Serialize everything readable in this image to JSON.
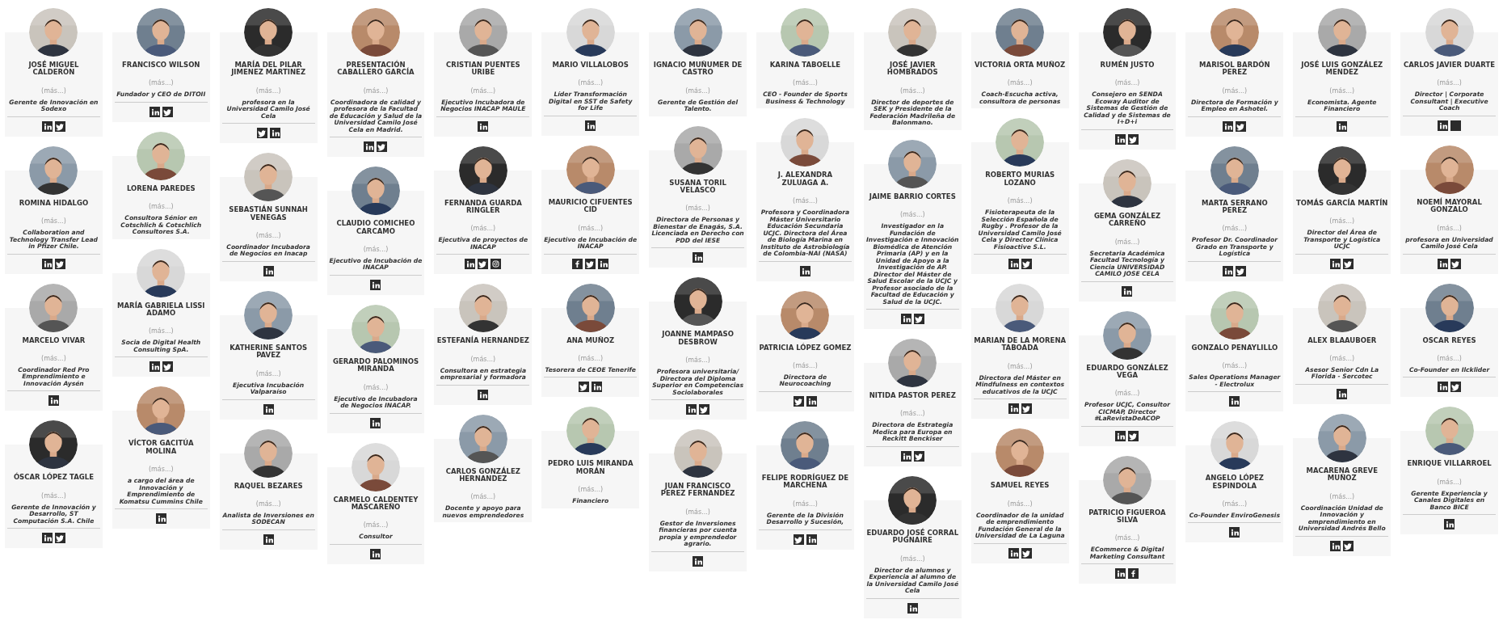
{
  "rows": [
    [
      {
        "name": "JOSÉ MIGUEL CALDERÓN",
        "more": "(más...)",
        "role": "Gerente de Innovación en Sodexo",
        "socials": [
          {
            "kind": "linkedin"
          },
          {
            "kind": "twitter"
          }
        ]
      },
      {
        "name": "FRANCISCO WILSON",
        "more": "(más...)",
        "role": "Fundador y CEO de DITOII",
        "socials": [
          {
            "kind": "linkedin"
          },
          {
            "kind": "twitter"
          }
        ]
      },
      {
        "name": "MARÍA DEL PILAR JIMENEZ MARTINEZ",
        "more": "(más...)",
        "role": "profesora en la Universidad Camilo José Cela",
        "socials": [
          {
            "kind": "twitter"
          },
          {
            "kind": "linkedin"
          }
        ]
      },
      {
        "name": "PRESENTACIÓN CABALLERO GARCÍA",
        "more": "(más...)",
        "role": "Coordinadora de calidad y profesora de la Facultad de Educación y Salud de la Universidad Camilo José Cela en Madrid.",
        "socials": [
          {
            "kind": "linkedin"
          },
          {
            "kind": "twitter"
          }
        ]
      },
      {
        "name": "CRISTIAN PUENTES URIBE",
        "more": "(más...)",
        "role": "Ejecutivo Incubadora de Negocios INACAP MAULE",
        "socials": [
          {
            "kind": "linkedin"
          }
        ]
      },
      {
        "name": "MARIO VILLALOBOS",
        "more": "(más...)",
        "role": "Líder Transformación Digital en SST de Safety for Life",
        "socials": [
          {
            "kind": "linkedin"
          }
        ]
      },
      {
        "name": "IGNACIO MUÑUMER DE CASTRO",
        "more": "(más...)",
        "role": "Gerente de Gestión del Talento."
      },
      {
        "name": "KARINA TABOELLE",
        "more": "(más...)",
        "role": "CEO - Founder de Sports Business & Technology"
      },
      {
        "name": "JOSÉ JAVIER HOMBRADOS",
        "more": "(más...)",
        "role": "Director de deportes de SEK y Presidente de la Federación Madrileña de Balonmano."
      },
      {
        "name": "VICTORIA ORTA MUÑOZ",
        "more": "(más...)",
        "role": "Coach-Escucha activa, consultora de personas"
      },
      {
        "name": "RUMÉN JUSTO",
        "more": "(más...)",
        "role": "Consejero en SENDA Ecoway Auditor de Sistemas de Gestión de Calidad y de Sistemas de I+D+i",
        "socials": [
          {
            "kind": "linkedin"
          },
          {
            "kind": "twitter"
          }
        ]
      },
      {
        "name": "MARISOL BARDÓN PEREZ",
        "more": "(más...)",
        "role": "Directora de Formación y Empleo en Ashotel.",
        "socials": [
          {
            "kind": "linkedin"
          },
          {
            "kind": "twitter"
          }
        ]
      },
      {
        "name": "JOSÉ LUIS GONZÁLEZ MENDEZ",
        "more": "(más...)",
        "role": "Economista. Agente Financiero",
        "socials": [
          {
            "kind": "linkedin"
          }
        ]
      },
      {
        "name": "CARLOS JAVIER DUARTE",
        "more": "(más...)",
        "role": "Director | Corporate Consultant | Executive Coach",
        "socials": [
          {
            "kind": "linkedin"
          },
          {
            "kind": "blank"
          }
        ]
      }
    ],
    [
      {
        "name": "ROMINA HIDALGO",
        "more": "(más...)",
        "role": "Collaboration and Technology Transfer Lead in Pfizer Chile.",
        "socials": [
          {
            "kind": "linkedin"
          },
          {
            "kind": "twitter"
          }
        ]
      },
      {
        "name": "LORENA PAREDES",
        "more": "(más...)",
        "role": "Consultora Sénior en Cotschlich & Cotschlich Consultores S.A."
      },
      {
        "name": "SEBASTIÁN SUNNAH VENEGAS",
        "more": "(más...)",
        "role": "Coordinador Incubadora de Negocios en Inacap",
        "socials": [
          {
            "kind": "linkedin"
          }
        ]
      },
      {
        "name": "CLAUDIO COMICHEO CARCAMO",
        "more": "(más...)",
        "role": "Ejecutivo de Incubación de INACAP",
        "socials": [
          {
            "kind": "linkedin"
          }
        ]
      },
      {
        "name": "FERNANDA GUARDA RINGLER",
        "more": "(más...)",
        "role": "Ejecutiva de proyectos de INACAP",
        "socials": [
          {
            "kind": "linkedin"
          },
          {
            "kind": "twitter"
          },
          {
            "kind": "instagram"
          }
        ]
      },
      {
        "name": "MAURICIO CIFUENTES CID",
        "more": "(más...)",
        "role": "Ejecutivo de Incubación de INACAP",
        "socials": [
          {
            "kind": "facebook"
          },
          {
            "kind": "twitter"
          },
          {
            "kind": "linkedin"
          }
        ]
      },
      {
        "name": "SUSANA TORIL VELASCO",
        "more": "(más...)",
        "role": "Directora de Personas y Bienestar de Enagás, S.A. Licenciada en Derecho con PDD del IESE",
        "socials": [
          {
            "kind": "linkedin"
          }
        ]
      },
      {
        "name": "J. ALEXANDRA ZULUAGA A.",
        "more": "(más...)",
        "role": "Profesora y Coordinadora Máster Universitario Educación Secundaria UCJC. Directora del Área de Biología Marina en Instituto de Astrobiología de Colombia-NAI (NASA)",
        "socials": [
          {
            "kind": "linkedin"
          }
        ]
      },
      {
        "name": "JAIME BARRIO CORTES",
        "more": "(más...)",
        "role": "Investigador en la Fundación de Investigación e Innovación Biomédica de Atención Primaria (AP) y en la Unidad de Apoyo a la Investigación de AP. Director del Máster de Salud Escolar de la UCJC y Profesor asociado de la Facultad de Educación y Salud de la UCJC.",
        "socials": [
          {
            "kind": "linkedin"
          },
          {
            "kind": "twitter"
          }
        ]
      },
      {
        "name": "ROBERTO MURIAS LOZANO",
        "more": "(más...)",
        "role": "Fisioterapeuta de la Selección Española de Rugby . Profesor de la Universidad Camilo José Cela y Director Clínica Fisioactive S.L.",
        "socials": [
          {
            "kind": "linkedin"
          },
          {
            "kind": "twitter"
          }
        ]
      },
      {
        "name": "GEMA GONZÁLEZ CARREÑO",
        "more": "(más...)",
        "role": "Secretaria Académica Facultad Tecnología y Ciencia UNIVERSIDAD CAMILO JOSE CELA",
        "socials": [
          {
            "kind": "linkedin"
          }
        ]
      },
      {
        "name": "MARTA SERRANO PEREZ",
        "more": "(más...)",
        "role": "Profesor Dr. Coordinador Grado en Transporte y Logística",
        "socials": [
          {
            "kind": "linkedin"
          },
          {
            "kind": "twitter"
          }
        ]
      },
      {
        "name": "TOMÁS GARCÍA MARTÍN",
        "more": "(más...)",
        "role": "Director del Área de Transporte y Logística UCJC",
        "socials": [
          {
            "kind": "linkedin"
          },
          {
            "kind": "twitter"
          }
        ]
      },
      {
        "name": "NOEMÍ MAYORAL GONZALO",
        "more": "(más...)",
        "role": "profesora en Universidad Camilo José Cela",
        "socials": [
          {
            "kind": "linkedin"
          },
          {
            "kind": "twitter"
          }
        ]
      }
    ],
    [
      {
        "name": "MARCELO VIVAR",
        "more": "(más...)",
        "role": "Coordinador Red Pro Emprendimiento e Innovación Aysén",
        "socials": [
          {
            "kind": "linkedin"
          }
        ]
      },
      {
        "name": "MARÍA GABRIELA LISSI ADAMO",
        "more": "(más...)",
        "role": "Socia de Digital Health Consulting SpA.",
        "socials": [
          {
            "kind": "linkedin"
          },
          {
            "kind": "twitter"
          }
        ]
      },
      {
        "name": "KATHERINE SANTOS PAVEZ",
        "more": "(más...)",
        "role": "Ejecutiva Incubación Valparaíso",
        "socials": [
          {
            "kind": "linkedin"
          }
        ]
      },
      {
        "name": "GERARDO PALOMINOS MIRANDA",
        "more": "(más...)",
        "role": "Ejecutivo de Incubadora de Negocios INACAP.",
        "socials": [
          {
            "kind": "linkedin"
          }
        ]
      },
      {
        "name": "ESTEFANÍA HERNANDEZ",
        "more": "(más...)",
        "role": "Consultora en estrategia empresarial y formadora",
        "socials": [
          {
            "kind": "linkedin"
          }
        ]
      },
      {
        "name": "ANA MUÑOZ",
        "more": "(más...)",
        "role": "Tesorera de CEOE Tenerife",
        "socials": [
          {
            "kind": "twitter"
          },
          {
            "kind": "linkedin"
          }
        ]
      },
      {
        "name": "JOANNE MAMPASO DESBROW",
        "more": "(más...)",
        "role": "Profesora universitaria/ Directora del Diploma Superior en Competencias Sociolaborales",
        "socials": [
          {
            "kind": "linkedin"
          },
          {
            "kind": "twitter"
          }
        ]
      },
      {
        "name": "PATRICIA LÓPEZ GOMEZ",
        "more": "(más...)",
        "role": "Directora de Neurocoaching",
        "socials": [
          {
            "kind": "twitter"
          },
          {
            "kind": "linkedin"
          }
        ]
      },
      {
        "name": "NITIDA PASTOR PEREZ",
        "more": "(más...)",
        "role": "Directora de Estrategia Medica para Europa en Reckitt Benckiser",
        "socials": [
          {
            "kind": "linkedin"
          },
          {
            "kind": "twitter"
          }
        ]
      },
      {
        "name": "MARIAN DE LA MORENA TABOADA",
        "more": "(más...)",
        "role": "Directora del Máster en Mindfulness en contextos educativos de la UCJC",
        "socials": [
          {
            "kind": "linkedin"
          },
          {
            "kind": "twitter"
          }
        ]
      },
      {
        "name": "EDUARDO GONZÁLEZ VEGA",
        "more": "(más...)",
        "role": "Profesor UCJC, Consultor CICMAP, Director #LaRevistaDeACOP",
        "socials": [
          {
            "kind": "linkedin"
          },
          {
            "kind": "twitter"
          }
        ]
      },
      {
        "name": "GONZALO PENAYLILLO",
        "more": "(más...)",
        "role": "Sales Operations Manager - Electrolux",
        "socials": [
          {
            "kind": "linkedin"
          }
        ]
      },
      {
        "name": "ALEX BLAAUBOER",
        "more": "(más...)",
        "role": "Asesor Senior Cdn La Florida - Sercotec",
        "socials": [
          {
            "kind": "linkedin"
          }
        ]
      },
      {
        "name": "OSCAR REYES",
        "more": "(más...)",
        "role": "Co-Founder en Ilcklider",
        "socials": [
          {
            "kind": "linkedin"
          },
          {
            "kind": "twitter"
          }
        ]
      }
    ],
    [
      {
        "name": "ÓSCAR LÓPEZ TAGLE",
        "more": "(más...)",
        "role": "Gerente de Innovación y Desarrollo, ST Computación S.A. Chile",
        "socials": [
          {
            "kind": "linkedin"
          },
          {
            "kind": "twitter"
          }
        ]
      },
      {
        "name": "VÍCTOR GACITÚA MOLINA",
        "more": "(más...)",
        "role": "a cargo del área de Innovación y Emprendimiento de Komatsu Cummins Chile",
        "socials": [
          {
            "kind": "linkedin"
          }
        ]
      },
      {
        "name": "RAQUEL BEZARES",
        "more": "(más...)",
        "role": "Analista de Inversiones en SODECAN",
        "socials": [
          {
            "kind": "linkedin"
          }
        ]
      },
      {
        "name": "CARMELO CALDENTEY MASCAREÑO",
        "more": "(más...)",
        "role": "Consultor",
        "socials": [
          {
            "kind": "linkedin"
          }
        ]
      },
      {
        "name": "CARLOS GONZÁLEZ HERNANDEZ",
        "more": "(más...)",
        "role": "Docente y apoyo para nuevos emprendedores"
      },
      {
        "name": "PEDRO LUIS MIRANDA MORÁN",
        "more": "(más...)",
        "role": "Financiero"
      },
      {
        "name": "JUAN FRANCISCO PEREZ FERNANDEZ",
        "more": "(más...)",
        "role": "Gestor de Inversiones financieras por cuenta propia y emprendedor agrario.",
        "socials": [
          {
            "kind": "linkedin"
          }
        ]
      },
      {
        "name": "FELIPE RODRÍGUEZ DE MARCHENA",
        "more": "(más...)",
        "role": "Gerente de la División Desarrollo y Sucesión,",
        "socials": [
          {
            "kind": "twitter"
          },
          {
            "kind": "linkedin"
          }
        ]
      },
      {
        "name": "EDUARDO JOSÉ CORRAL PUGNAIRE",
        "more": "(más...)",
        "role": "Director de alumnos y Experiencia al alumno de la Universidad Camilo José Cela",
        "socials": [
          {
            "kind": "linkedin"
          }
        ]
      },
      {
        "name": "SAMUEL REYES",
        "more": "(más...)",
        "role": "Coordinador de la unidad de emprendimiento Fundación General de la Universidad de La Laguna",
        "socials": [
          {
            "kind": "linkedin"
          },
          {
            "kind": "twitter"
          }
        ]
      },
      {
        "name": "PATRICIO FIGUEROA SILVA",
        "more": "(más...)",
        "role": "ECommerce & Digital Marketing Consultant",
        "socials": [
          {
            "kind": "linkedin"
          },
          {
            "kind": "facebook"
          }
        ]
      },
      {
        "name": "ANGELO LÓPEZ ESPINDOLA",
        "more": "(más...)",
        "role": "Co-Founder EnviroGenesis",
        "socials": [
          {
            "kind": "linkedin"
          }
        ]
      },
      {
        "name": "MACARENA GREVE MUÑOZ",
        "more": "(más...)",
        "role": "Coordinación Unidad de Innovación y emprendimiento en Universidad Andrés Bello",
        "socials": [
          {
            "kind": "linkedin"
          },
          {
            "kind": "twitter"
          }
        ]
      },
      {
        "name": "ENRIQUE VILLARROEL",
        "more": "(más...)",
        "role": "Gerente Experiencia y Canales Digitales en Banco BICE",
        "socials": [
          {
            "kind": "linkedin"
          }
        ]
      }
    ]
  ]
}
